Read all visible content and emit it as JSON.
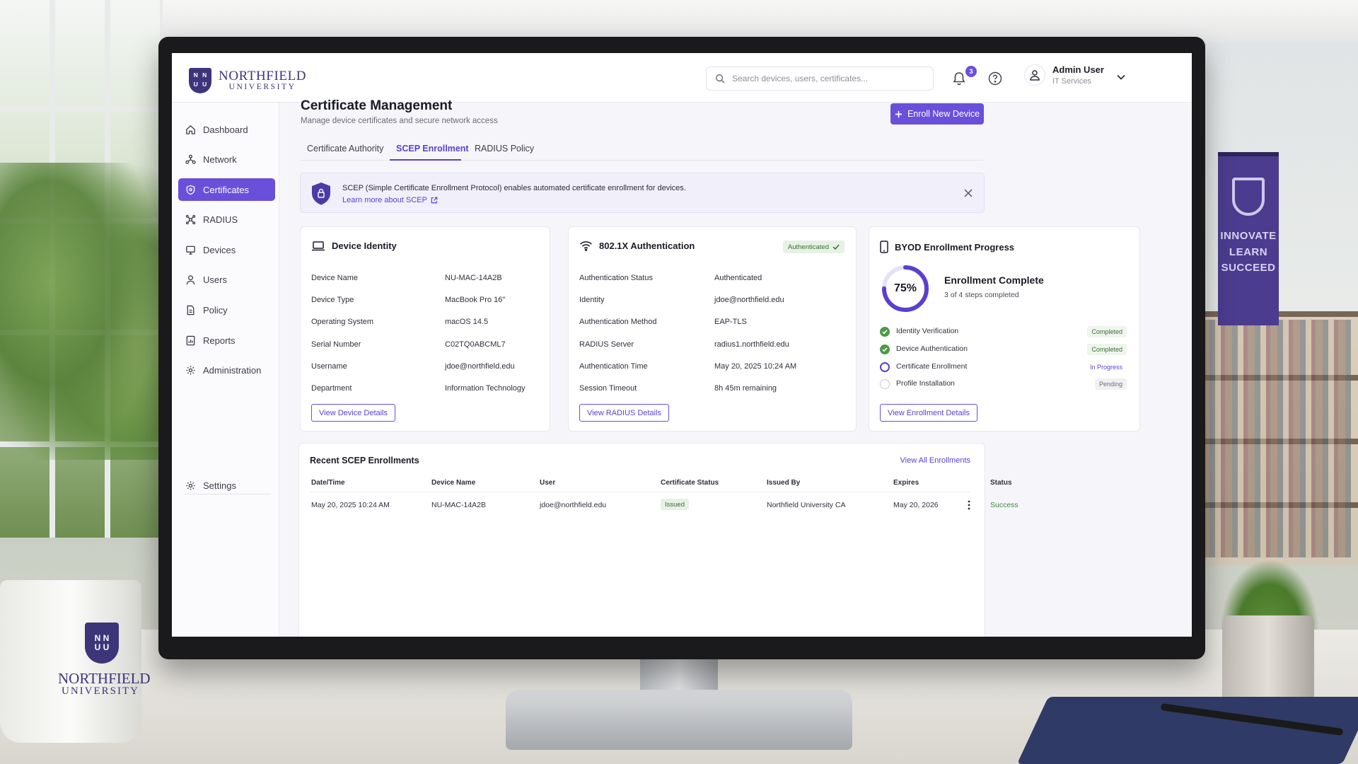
{
  "app": {
    "logo_name": "NORTHFIELD",
    "logo_sub": "UNIVERSITY",
    "logo_letters": [
      "N",
      "N",
      "U",
      "U"
    ]
  },
  "header": {
    "search_placeholder": "Search devices, users, certificates...",
    "notification_count": "3",
    "user_name": "Admin User",
    "user_role": "IT Services"
  },
  "sidebar": {
    "items": [
      {
        "label": "Dashboard",
        "icon": "home-icon",
        "active": false
      },
      {
        "label": "Network",
        "icon": "network-icon",
        "active": false
      },
      {
        "label": "Certificates",
        "icon": "certificate-icon",
        "active": true
      },
      {
        "label": "RADIUS",
        "icon": "radius-icon",
        "active": false
      },
      {
        "label": "Devices",
        "icon": "monitor-icon",
        "active": false
      },
      {
        "label": "Users",
        "icon": "user-icon",
        "active": false
      },
      {
        "label": "Policy",
        "icon": "policy-icon",
        "active": false
      },
      {
        "label": "Reports",
        "icon": "reports-icon",
        "active": false
      },
      {
        "label": "Administration",
        "icon": "gear-icon",
        "active": false
      }
    ],
    "settings_label": "Settings"
  },
  "page": {
    "title": "Certificate Management",
    "subtitle": "Manage device certificates and secure network access",
    "enroll_button": "Enroll New Device",
    "tabs": [
      {
        "label": "Certificate Authority",
        "active": false
      },
      {
        "label": "SCEP Enrollment",
        "active": true
      },
      {
        "label": "RADIUS Policy",
        "active": false
      }
    ]
  },
  "info_banner": {
    "text": "SCEP (Simple Certificate Enrollment Protocol) enables automated certificate enrollment for devices.",
    "link": "Learn more about SCEP"
  },
  "device_identity": {
    "title": "Device Identity",
    "rows": [
      {
        "k": "Device Name",
        "v": "NU-MAC-14A2B"
      },
      {
        "k": "Device Type",
        "v": "MacBook Pro 16\""
      },
      {
        "k": "Operating System",
        "v": "macOS 14.5"
      },
      {
        "k": "Serial Number",
        "v": "C02TQ0ABCML7"
      },
      {
        "k": "Username",
        "v": "jdoe@northfield.edu"
      },
      {
        "k": "Department",
        "v": "Information Technology"
      }
    ],
    "button": "View Device Details"
  },
  "auth": {
    "title": "802.1X Authentication",
    "status_pill": "Authenticated",
    "rows": [
      {
        "k": "Authentication Status",
        "v": "Authenticated"
      },
      {
        "k": "Identity",
        "v": "jdoe@northfield.edu"
      },
      {
        "k": "Authentication Method",
        "v": "EAP-TLS"
      },
      {
        "k": "RADIUS Server",
        "v": "radius1.northfield.edu"
      },
      {
        "k": "Authentication Time",
        "v": "May 20, 2025 10:24 AM"
      },
      {
        "k": "Session Timeout",
        "v": "8h 45m remaining"
      }
    ],
    "button": "View RADIUS Details"
  },
  "byod": {
    "title": "BYOD Enrollment Progress",
    "percent_label": "75%",
    "percent": 0.75,
    "headline": "Enrollment Complete",
    "steps_summary": "3 of 4 steps completed",
    "steps": [
      {
        "label": "Identity Verification",
        "status": "Completed",
        "state": "done"
      },
      {
        "label": "Device Authentication",
        "status": "Completed",
        "state": "done"
      },
      {
        "label": "Certificate Enrollment",
        "status": "In Progress",
        "state": "progress"
      },
      {
        "label": "Profile Installation",
        "status": "Pending",
        "state": "pending"
      }
    ],
    "button": "View Enrollment Details"
  },
  "recent": {
    "title": "Recent SCEP Enrollments",
    "view_all": "View All Enrollments",
    "columns": [
      "Date/Time",
      "Device Name",
      "User",
      "Certificate Status",
      "Issued By",
      "Expires",
      "Status"
    ],
    "rows": [
      {
        "datetime": "May 20, 2025 10:24 AM",
        "device": "NU-MAC-14A2B",
        "user": "jdoe@northfield.edu",
        "cert_status": "Issued",
        "issued_by": "Northfield University CA",
        "expires": "May 20, 2026",
        "status": "Success"
      }
    ]
  },
  "scene": {
    "banner_text": [
      "INNOVATE",
      "LEARN",
      "SUCCEED"
    ],
    "mug_name": "NORTHFIELD",
    "mug_sub": "UNIVERSITY"
  },
  "colors": {
    "accent": "#6a4fdb",
    "brand": "#3e347c",
    "success": "#3d8a3a",
    "progress": "#5a3fd0"
  }
}
